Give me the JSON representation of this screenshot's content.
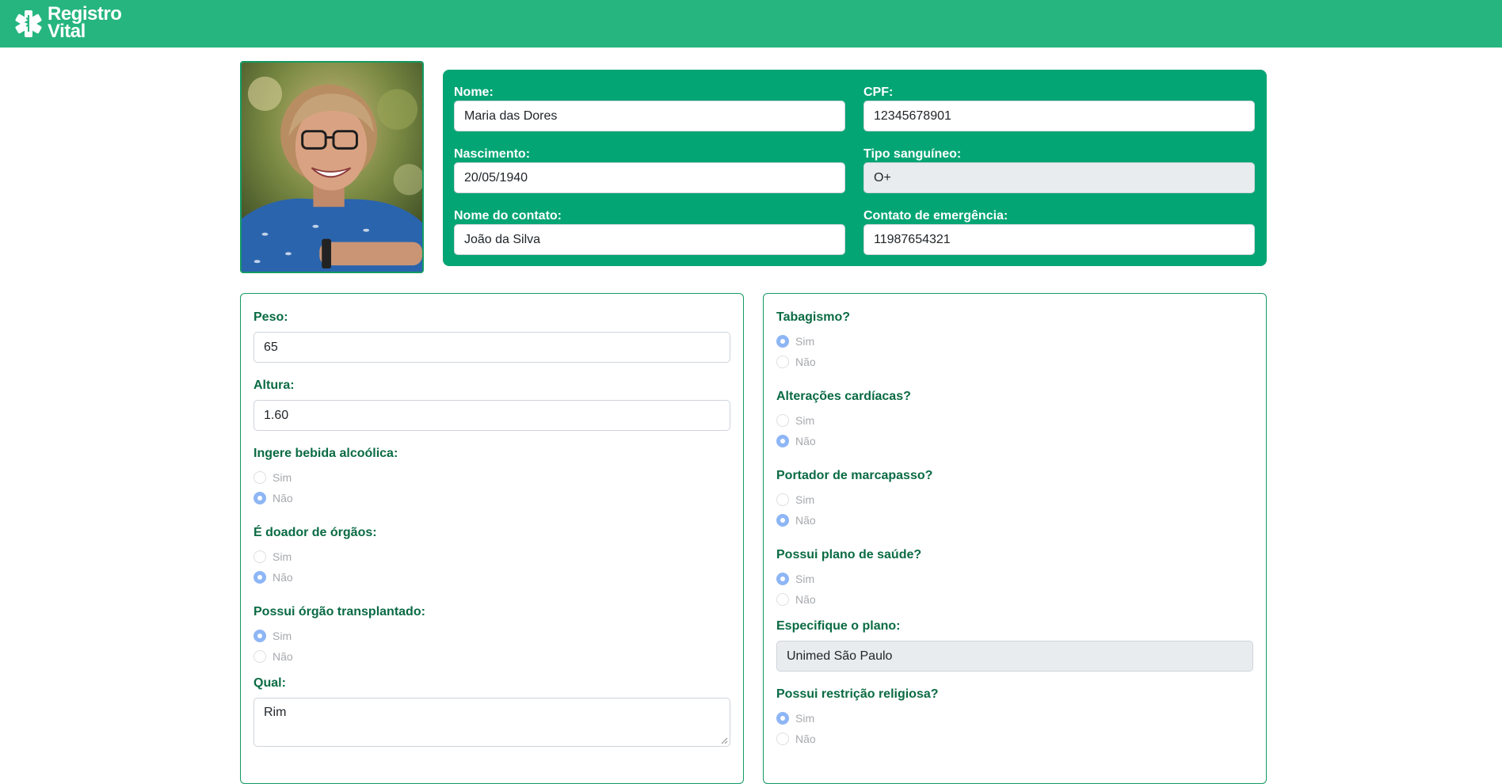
{
  "brand": {
    "line1": "Registro",
    "line2": "Vital",
    "icon": "medical-cross-icon"
  },
  "colors": {
    "navbar": "#26b57f",
    "card": "#04a574",
    "label": "#0a6b43",
    "border": "#139a64",
    "radio_checked": "#8eb6f5"
  },
  "identity": {
    "nome": {
      "label": "Nome:",
      "value": "Maria das Dores"
    },
    "cpf": {
      "label": "CPF:",
      "value": "12345678901"
    },
    "nascimento": {
      "label": "Nascimento:",
      "value": "20/05/1940"
    },
    "tipo_sanguineo": {
      "label": "Tipo sanguíneo:",
      "value": "O+"
    },
    "nome_contato": {
      "label": "Nome do contato:",
      "value": "João da Silva"
    },
    "contato_emergencia": {
      "label": "Contato de emergência:",
      "value": "11987654321"
    }
  },
  "left": {
    "peso": {
      "label": "Peso:",
      "value": "65"
    },
    "altura": {
      "label": "Altura:",
      "value": "1.60"
    },
    "alcool": {
      "label": "Ingere bebida alcoólica:",
      "yes": "Sim",
      "no": "Não",
      "selected": "Não"
    },
    "doador": {
      "label": "É doador de órgãos:",
      "yes": "Sim",
      "no": "Não",
      "selected": "Não"
    },
    "transplante": {
      "label": "Possui órgão transplantado:",
      "yes": "Sim",
      "no": "Não",
      "selected": "Sim"
    },
    "qual": {
      "label": "Qual:",
      "value": "Rim"
    }
  },
  "right": {
    "tabagismo": {
      "label": "Tabagismo?",
      "yes": "Sim",
      "no": "Não",
      "selected": "Sim"
    },
    "cardiacas": {
      "label": "Alterações cardíacas?",
      "yes": "Sim",
      "no": "Não",
      "selected": "Não"
    },
    "marcapasso": {
      "label": "Portador de marcapasso?",
      "yes": "Sim",
      "no": "Não",
      "selected": "Não"
    },
    "plano": {
      "label": "Possui plano de saúde?",
      "yes": "Sim",
      "no": "Não",
      "selected": "Sim"
    },
    "especifique": {
      "label": "Especifique o plano:",
      "value": "Unimed São Paulo"
    },
    "religiosa": {
      "label": "Possui restrição religiosa?",
      "yes": "Sim",
      "no": "Não",
      "selected": "Sim"
    }
  }
}
